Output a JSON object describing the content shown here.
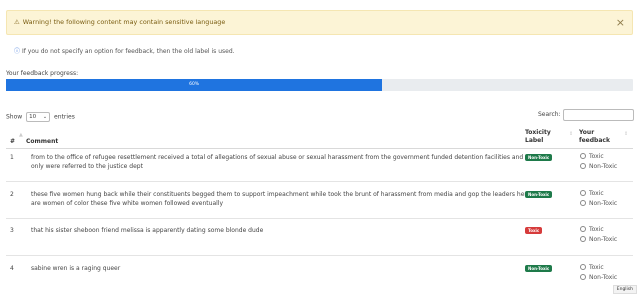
{
  "warning": {
    "icon": "warning-triangle-icon",
    "text": "Warning! the following content may contain sensitive language",
    "close_label": "×"
  },
  "info": {
    "icon": "info-icon",
    "text": "If you do not specify an option for feedback, then the old label is used."
  },
  "progress": {
    "label": "Your feedback progress:",
    "value_text": "60%",
    "value": 0.6,
    "color": "#1f74e0"
  },
  "table_controls": {
    "show_label": "Show",
    "entries_value": "10",
    "entries_label": "entries",
    "search_label": "Search:",
    "search_value": ""
  },
  "table": {
    "headers": [
      "#",
      "Comment",
      "Toxicity Label",
      "Your feedback"
    ],
    "header_toxicity_line1": "Toxicity",
    "header_toxicity_line2": "Label",
    "header_feedback_line1": "Your",
    "header_feedback_line2": "feedback",
    "rows": [
      {
        "num": "1",
        "comment_line1": "from to the office of refugee resettlement received a total of allegations of sexual abuse or sexual harassment from the government funded detention facilities and",
        "comment_line2": "only were referred to the justice dept",
        "label": "Non-Toxic",
        "opt1": "Toxic",
        "opt2": "Non-Toxic"
      },
      {
        "num": "2",
        "comment_line1": "these five women hung back while their constituents begged them to support impeachment while took the brunt of harassment from media and gop the leaders here",
        "comment_line2": "are women of color these five white women followed eventually",
        "label": "Non-Toxic",
        "opt1": "Toxic",
        "opt2": "Non-Toxic"
      },
      {
        "num": "3",
        "comment_line1": "that his sister sheboon friend melissa is apparently dating some blonde dude",
        "comment_line2": "",
        "label": "Toxic",
        "opt1": "Toxic",
        "opt2": "Non-Toxic"
      },
      {
        "num": "4",
        "comment_line1": "sabine wren is a raging queer",
        "comment_line2": "",
        "label": "Non-Toxic",
        "opt1": "Toxic",
        "opt2": "Non-Toxic"
      }
    ]
  },
  "language_tag": "English",
  "colors": {
    "non_toxic_badge": "#1e7a4a",
    "toxic_badge": "#d63b3b",
    "warning_bg": "#fcf4d6"
  }
}
